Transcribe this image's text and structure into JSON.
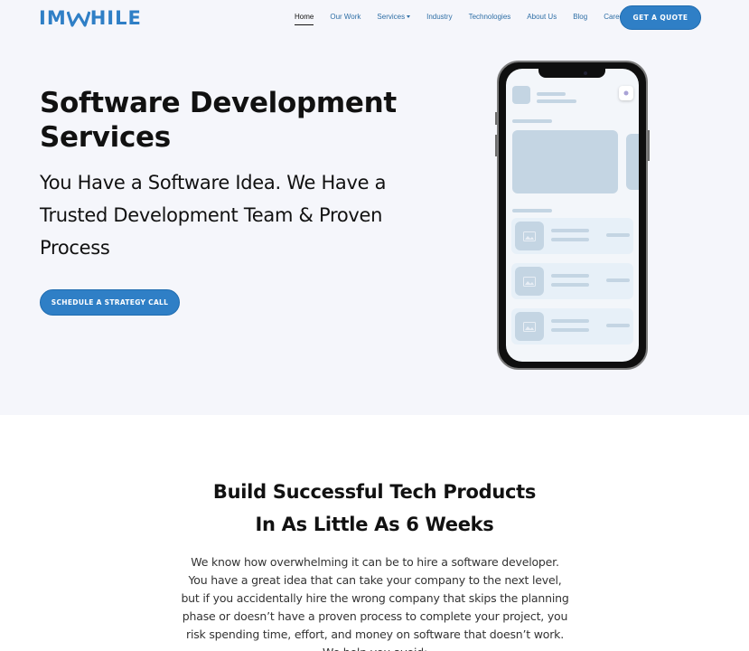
{
  "header": {
    "logo_text_left": "IM",
    "logo_text_right": "HILE",
    "nav": [
      {
        "label": "Home",
        "active": true
      },
      {
        "label": "Our Work"
      },
      {
        "label": "Services",
        "dropdown": true
      },
      {
        "label": "Industry"
      },
      {
        "label": "Technologies"
      },
      {
        "label": "About Us"
      },
      {
        "label": "Blog"
      },
      {
        "label": "Career"
      }
    ],
    "quote_button": "GET A QUOTE"
  },
  "hero": {
    "title": "Software Development Services",
    "subtitle": "You Have a Software Idea. We Have a Trusted Development Team & Proven Process",
    "cta": "SCHEDULE A STRATEGY CALL"
  },
  "section": {
    "title_line1": "Build Successful Tech Products",
    "title_line2": "In As Little As 6 Weeks",
    "body": "We know how overwhelming it can be to hire a software developer. You have a great idea that can take your company to the next level, but if you accidentally hire the wrong company that skips the planning phase or doesn’t have a proven process to complete your project, you risk spending time, effort, and money on software that doesn’t work. We help you avoid:"
  },
  "colors": {
    "brand": "#2f7fc6",
    "hero_bg": "#f5f6fb",
    "skeleton": "#c4d5e3"
  }
}
